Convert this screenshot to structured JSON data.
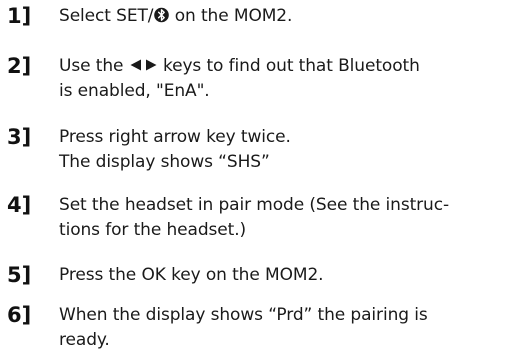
{
  "steps": [
    {
      "number": "1]",
      "lines": [
        {
          "before_icon": "Select SET/",
          "icon": "bluetooth-icon",
          "after_icon": " on the MOM2."
        }
      ]
    },
    {
      "number": "2]",
      "lines": [
        {
          "before_icon": "Use the ",
          "icons": [
            "left-arrow-icon",
            "right-arrow-icon"
          ],
          "after_icon": " keys to find out that Bluetooth"
        },
        {
          "text": "is enabled, \"EnA\"."
        }
      ]
    },
    {
      "number": "3]",
      "lines": [
        {
          "text": "Press right arrow key twice."
        },
        {
          "text": "The display shows “SHS”"
        }
      ]
    },
    {
      "number": "4]",
      "lines": [
        {
          "text": "Set the headset in pair mode (See the instruc-"
        },
        {
          "text": "tions for the headset.)"
        }
      ]
    },
    {
      "number": "5]",
      "lines": [
        {
          "text": "Press the OK key on the MOM2."
        }
      ]
    },
    {
      "number": "6]",
      "lines": [
        {
          "text": "When the display shows “Prd” the pairing is"
        },
        {
          "text": "ready."
        }
      ]
    }
  ]
}
